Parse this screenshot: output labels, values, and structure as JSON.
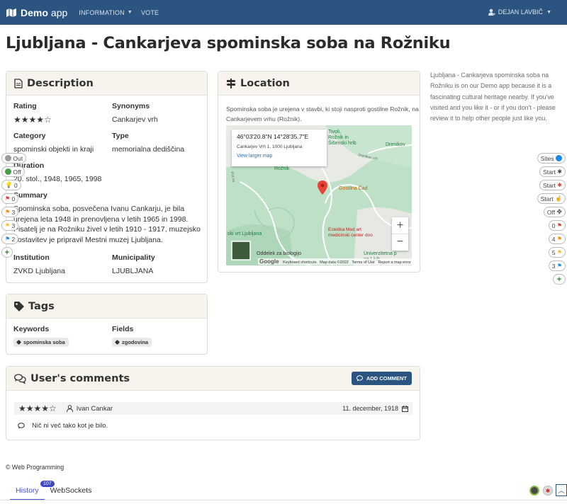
{
  "navbar": {
    "brand_bold": "Demo",
    "brand_normal": "app",
    "information": "INFORMATION",
    "vote": "VOTE",
    "user": "DEJAN LAVBIČ"
  },
  "page_title": "Ljubljana - Cankarjeva spominska soba na Rožniku",
  "description": {
    "header": "Description",
    "rating_label": "Rating",
    "rating_value": 4,
    "rating_max": 5,
    "synonyms_label": "Synonyms",
    "synonyms_value": "Cankarjev vrh",
    "category_label": "Category",
    "category_value": "spominski objekti in kraji",
    "type_label": "Type",
    "type_value": "memorialna dediščina",
    "duration_label": "Duration",
    "duration_value": "20. stol., 1948, 1965, 1998",
    "summary_label": "Summary",
    "summary_value": "Spominska soba, posvečena Ivanu Cankarju, je bila urejena leta 1948 in prenovljena v letih 1965 in 1998. Pisatelj je na Rožniku živel v letih 1910 - 1917, muzejsko postavitev je pripravil Mestni muzej Ljubljana.",
    "institution_label": "Institution",
    "institution_value": "ZVKD Ljubljana",
    "municipality_label": "Municipality",
    "municipality_value": "LJUBLJANA"
  },
  "location": {
    "header": "Location",
    "text": "Spominska soba je urejena v stavbi, ki stoji nasproti gostilne Rožnik, na Cankarjevem vrhu (Rožnik).",
    "map": {
      "coords": "46°03'20.8\"N 14°28'35.7\"E",
      "address": "Cankarjev Vrh 1, 1000 Ljubljana",
      "larger": "View larger map",
      "labels": {
        "tivoli": "Tivoli,\nRožnik in\nŠišenski hrib",
        "droenikova": "Drenikov",
        "droenikova_road": "Drenikov vrh",
        "roznik": "Rožnik",
        "gostilna": "Gostilna Čad",
        "estetika": "Estetika Med art\nmedicinski center doo",
        "vrt": "ski vrt Ljubljana",
        "oddelek": "Oddelek za biologijo",
        "univerzitetna": "Univerzitetna p\nna Ljub",
        "road_left": "Pot na"
      },
      "footer": {
        "google": "Google",
        "shortcuts": "Keyboard shortcuts",
        "mapdata": "Map data ©2022",
        "terms": "Terms of Use",
        "report": "Report a map error"
      },
      "zoom_in": "+",
      "zoom_out": "−"
    }
  },
  "side_text": "Ljubljana - Cankarjeva spominska soba na Rožniku is on our Demo app because it is a fascinating cultural heritage nearby. If you've visited and you like it - or if you don't - please review it to help other people just like you.",
  "tags": {
    "header": "Tags",
    "keywords_label": "Keywords",
    "keywords": [
      "spominska soba"
    ],
    "fields_label": "Fields",
    "fields": [
      "zgodovina"
    ]
  },
  "comments": {
    "header": "User's comments",
    "add_button": "ADD COMMENT",
    "items": [
      {
        "rating": 4,
        "author": "Ivan Cankar",
        "date": "11. december, 1918",
        "text": "Nič ni več tako kot je bilo."
      }
    ]
  },
  "footer": "© Web Programming",
  "tabs": [
    {
      "label": "History",
      "badge": "107"
    },
    {
      "label": "WebSockets"
    }
  ],
  "left_widget": {
    "out": "Out",
    "off": "Off",
    "c1": "0",
    "c2": "0",
    "c3": "3",
    "c4": "3",
    "c5": "2"
  },
  "right_widget": {
    "sites": "Sites",
    "start1": "Start",
    "start2": "Start",
    "start3": "Start",
    "off": "Off",
    "c1": "0",
    "c2": "4",
    "c3": "5",
    "c4": "3"
  },
  "colors": {
    "navbar": "#2c5480",
    "accent_tab": "#4a53c9",
    "marker": "#ea4335"
  }
}
